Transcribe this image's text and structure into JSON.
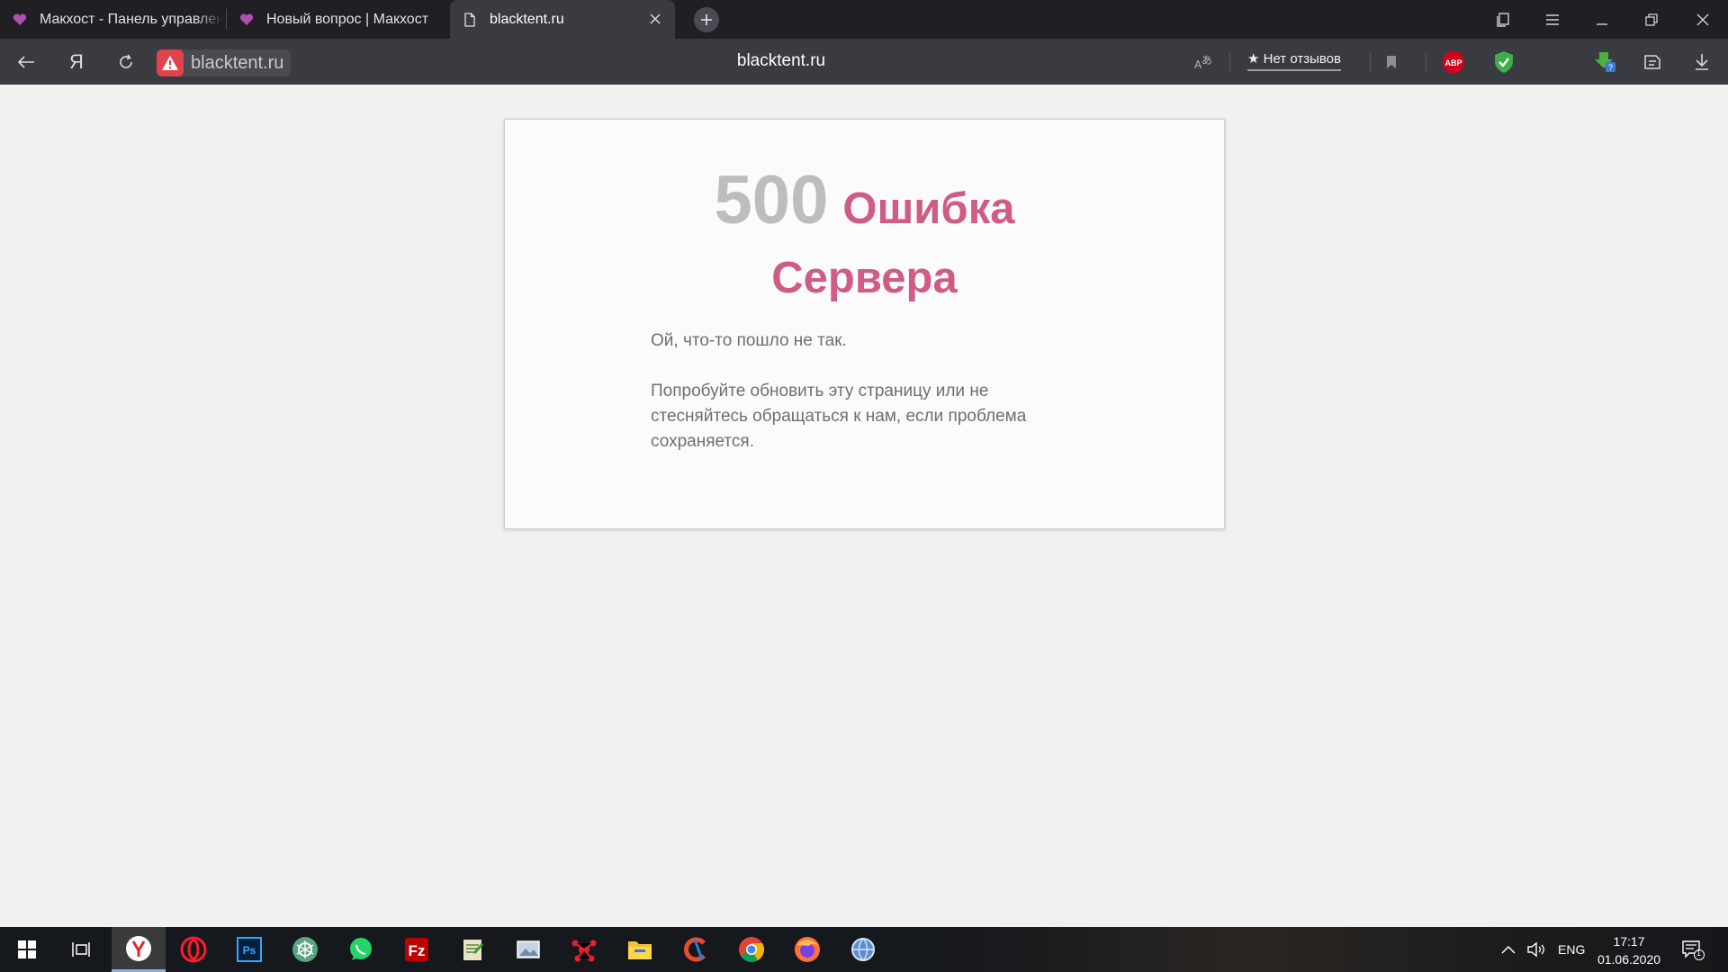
{
  "browser": {
    "tabs": [
      {
        "title": "Макхост - Панель управления",
        "icon": "heart-favicon",
        "active": false
      },
      {
        "title": "Новый вопрос | Макхост",
        "icon": "heart-favicon",
        "active": false
      },
      {
        "title": "blacktent.ru",
        "icon": "page-favicon",
        "active": true
      }
    ],
    "address": {
      "short_url": "blacktent.ru",
      "page_title": "blacktent.ru",
      "security_icon": "warning-icon"
    },
    "reviews_label": "★ Нет отзывов",
    "extensions": [
      "translate-icon",
      "bookmark-icon",
      "adblock-plus-icon",
      "shield-check-icon",
      "download-master-icon",
      "reader-icon",
      "download-icon"
    ],
    "colors": {
      "tab_strip": "#1f1f24",
      "toolbar": "#3a3a41",
      "warning": "#e0434c"
    }
  },
  "error_page": {
    "code": "500",
    "title_line1": "Ошибка",
    "title_line2": "Сервера",
    "message": "Ой, что-то пошло не так.",
    "hint": "Попробуйте обновить эту страницу или не стесняйтесь обращаться к нам, если проблема сохраняется.",
    "colors": {
      "code": "#bdbdbd",
      "title": "#cf5c86",
      "text": "#6f6f6f"
    }
  },
  "taskbar": {
    "apps": [
      "start-icon",
      "task-view-icon",
      "yandex-browser-icon",
      "opera-icon",
      "photoshop-icon",
      "chatgpt-icon",
      "whatsapp-icon",
      "filezilla-icon",
      "notepad-icon",
      "image-viewer-icon",
      "network-icon",
      "file-explorer-icon",
      "ccleaner-icon",
      "chrome-icon",
      "firefox-icon",
      "globe-app-icon"
    ],
    "tray": {
      "language": "ENG",
      "time": "17:17",
      "date": "01.06.2020",
      "notifications": "1"
    }
  }
}
